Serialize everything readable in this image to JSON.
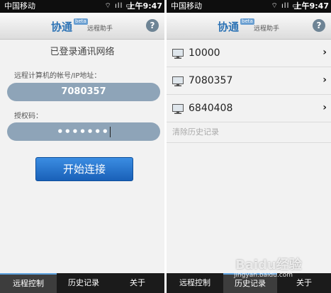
{
  "left": {
    "statusbar": {
      "carrier": "中国移动",
      "icons": "⌔ ıll ▭",
      "time": "上午9:47"
    },
    "header": {
      "logo": "协通",
      "beta": "beta",
      "subtitle": "远程助手",
      "help": "?"
    },
    "status_title": "已登录通讯网络",
    "account_label": "远程计算机的帐号/IP地址：",
    "account_value": "7080357",
    "auth_label": "授权码：",
    "auth_value": "•••••••",
    "connect_button": "开始连接",
    "tabs": [
      "远程控制",
      "历史记录",
      "关于"
    ]
  },
  "right": {
    "statusbar": {
      "carrier": "中国移动",
      "icons": "⌔ ıll ▭",
      "time": "上午9:47"
    },
    "header": {
      "logo": "协通",
      "beta": "beta",
      "subtitle": "远程助手",
      "help": "?"
    },
    "history": [
      "10000",
      "7080357",
      "6840408"
    ],
    "clear_history": "清除历史记录",
    "tabs": [
      "远程控制",
      "历史记录",
      "关于"
    ]
  },
  "watermark": {
    "text": "Baidu经验",
    "url": "jingyan.baidu.com"
  }
}
